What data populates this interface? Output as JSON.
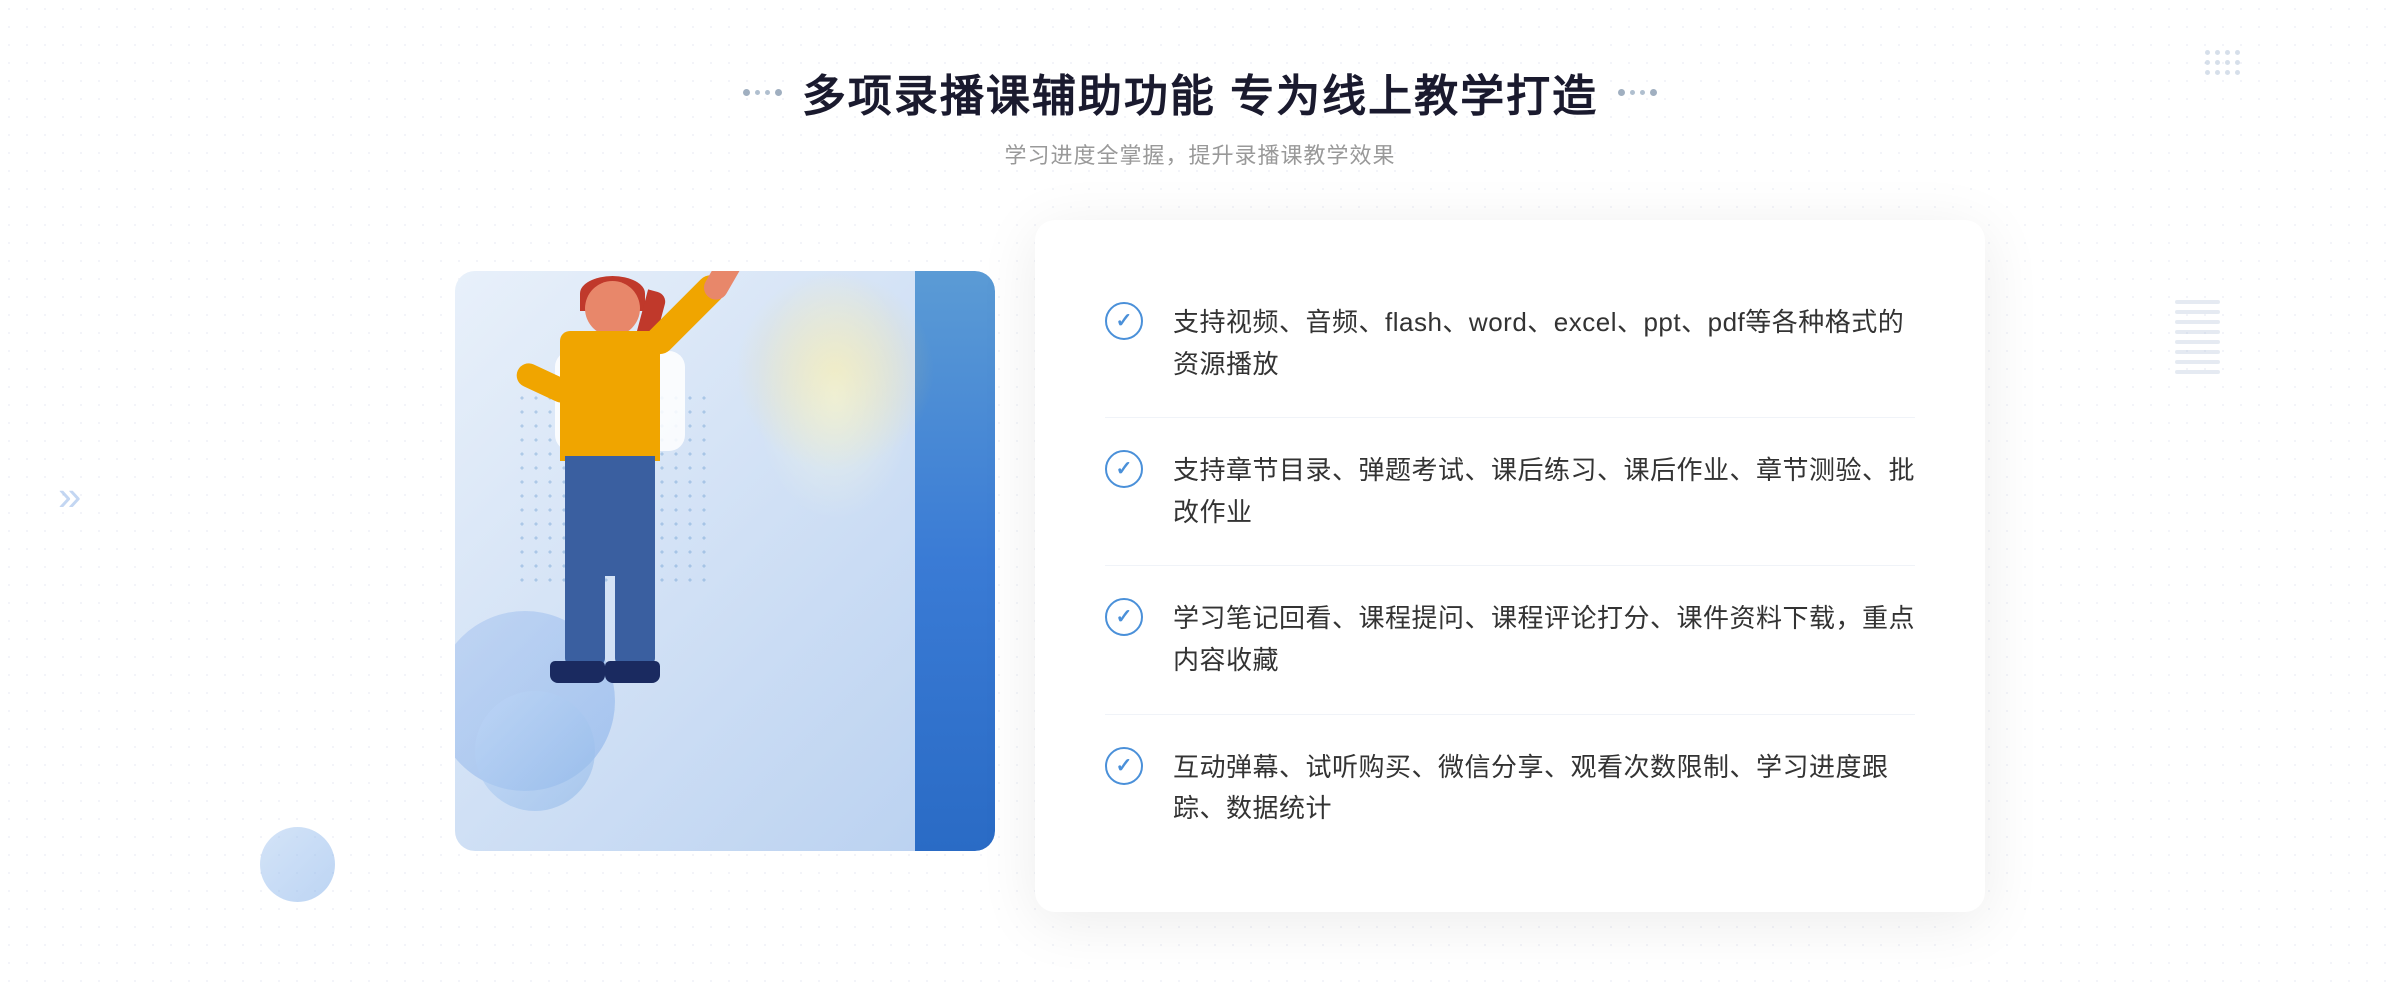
{
  "header": {
    "title": "多项录播课辅助功能 专为线上教学打造",
    "subtitle": "学习进度全掌握，提升录播课教学效果",
    "title_dots_label": "decorative dots"
  },
  "features": [
    {
      "id": 1,
      "text": "支持视频、音频、flash、word、excel、ppt、pdf等各种格式的资源播放"
    },
    {
      "id": 2,
      "text": "支持章节目录、弹题考试、课后练习、课后作业、章节测验、批改作业"
    },
    {
      "id": 3,
      "text": "学习笔记回看、课程提问、课程评论打分、课件资料下载，重点内容收藏"
    },
    {
      "id": 4,
      "text": "互动弹幕、试听购买、微信分享、观看次数限制、学习进度跟踪、数据统计"
    }
  ],
  "illustration": {
    "alt": "录播课辅助功能插图"
  },
  "colors": {
    "primary": "#3a7bd5",
    "text_dark": "#1a1a2e",
    "text_grey": "#999999",
    "text_body": "#333333",
    "check_color": "#4a90d9",
    "bg_white": "#ffffff"
  }
}
